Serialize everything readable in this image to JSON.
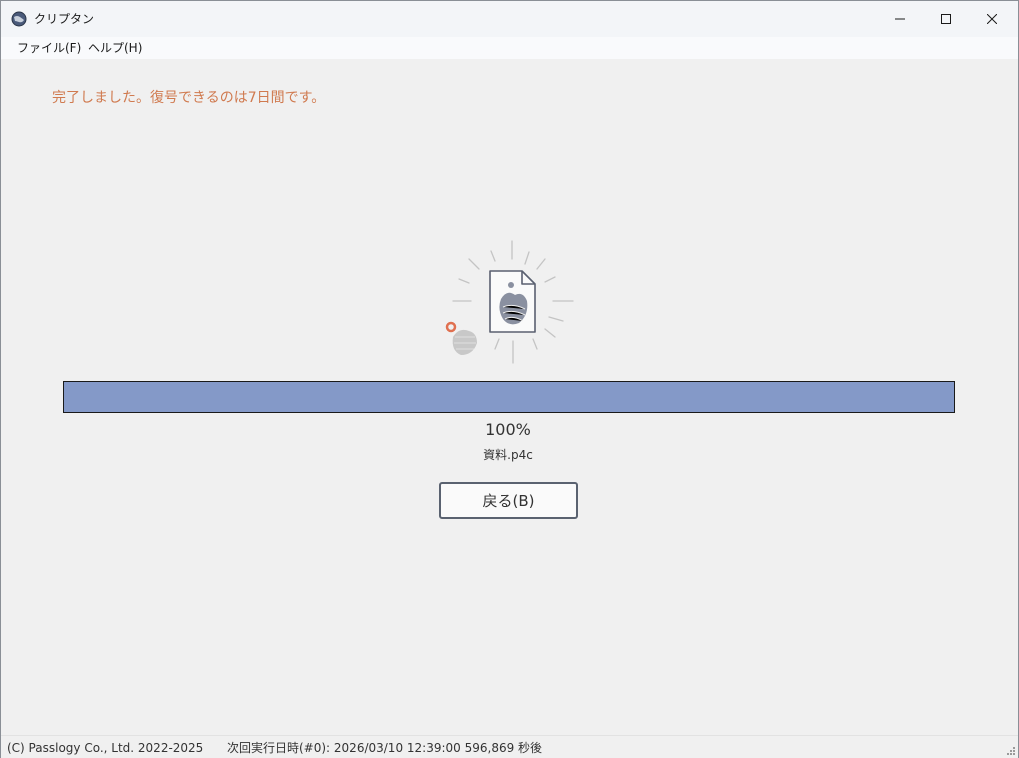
{
  "window": {
    "title": "クリプタン"
  },
  "menu": {
    "file": "ファイル(F)",
    "help": "ヘルプ(H)"
  },
  "main": {
    "status_message": "完了しました。復号できるのは7日間です。",
    "progress_percent": 100,
    "progress_label": "100%",
    "filename": "資料.p4c",
    "back_button": "戻る(B)"
  },
  "statusbar": {
    "copyright": "(C) Passlogy Co., Ltd. 2022-2025",
    "next_run": "次回実行日時(#0): 2026/03/10 12:39:00  596,869  秒後"
  },
  "icons": {
    "app": "globe-icon",
    "minimize": "minimize-icon",
    "maximize": "maximize-icon",
    "close": "close-icon",
    "illustration": "document-radiating-icon",
    "resize": "resize-grip-icon"
  },
  "colors": {
    "accent_message": "#d07a4f",
    "progress_fill": "#8499c8",
    "window_bg": "#f0f0f0"
  }
}
